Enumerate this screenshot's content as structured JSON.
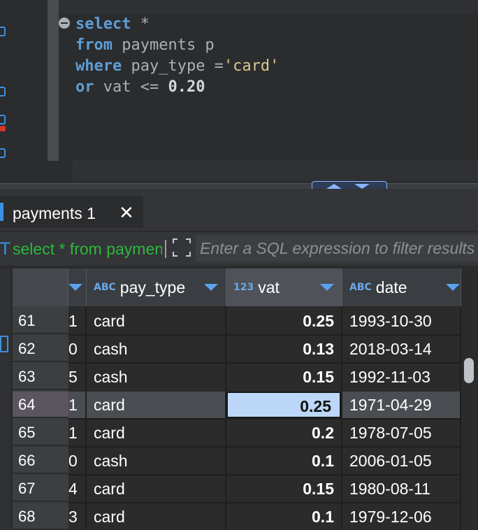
{
  "editor": {
    "lines": [
      {
        "kw": "select",
        "rest": " *"
      },
      {
        "kw": "from",
        "rest": " payments p"
      },
      {
        "kw": "where",
        "rest": " pay_type =",
        "str": "'card'"
      },
      {
        "kw": "or",
        "rest": " vat <= ",
        "num": "0.20"
      }
    ]
  },
  "results": {
    "tab_label": "payments 1",
    "tab_close": "✕",
    "filter": {
      "prefix_glyph": "T",
      "query": "select * from payments p",
      "placeholder": "Enter a SQL expression to filter results"
    },
    "columns": [
      {
        "name": "",
        "type": ""
      },
      {
        "name": "pay_type",
        "type": "ABC"
      },
      {
        "name": "vat",
        "type": "123"
      },
      {
        "name": "date",
        "type": "ABC"
      }
    ],
    "rows": [
      {
        "num": "61",
        "id": "1",
        "pay_type": "card",
        "vat": "0.25",
        "date": "1993-10-30"
      },
      {
        "num": "62",
        "id": "0",
        "pay_type": "cash",
        "vat": "0.13",
        "date": "2018-03-14"
      },
      {
        "num": "63",
        "id": "5",
        "pay_type": "cash",
        "vat": "0.15",
        "date": "1992-11-03"
      },
      {
        "num": "64",
        "id": "1",
        "pay_type": "card",
        "vat": "0.25",
        "date": "1971-04-29"
      },
      {
        "num": "65",
        "id": "1",
        "pay_type": "card",
        "vat": "0.2",
        "date": "1978-07-05"
      },
      {
        "num": "66",
        "id": "0",
        "pay_type": "cash",
        "vat": "0.1",
        "date": "2006-01-05"
      },
      {
        "num": "67",
        "id": "4",
        "pay_type": "card",
        "vat": "0.15",
        "date": "1980-08-11"
      },
      {
        "num": "68",
        "id": "3",
        "pay_type": "card",
        "vat": "0.1",
        "date": "1979-12-06"
      }
    ],
    "selected_row": "64",
    "focused_cell": "vat"
  },
  "colors": {
    "keyword": "#5e9ed6",
    "string": "#d7c88b",
    "accent": "#3d8fe0",
    "filter_query": "#2db83d",
    "focused_cell_bg": "#bcd7f7"
  }
}
